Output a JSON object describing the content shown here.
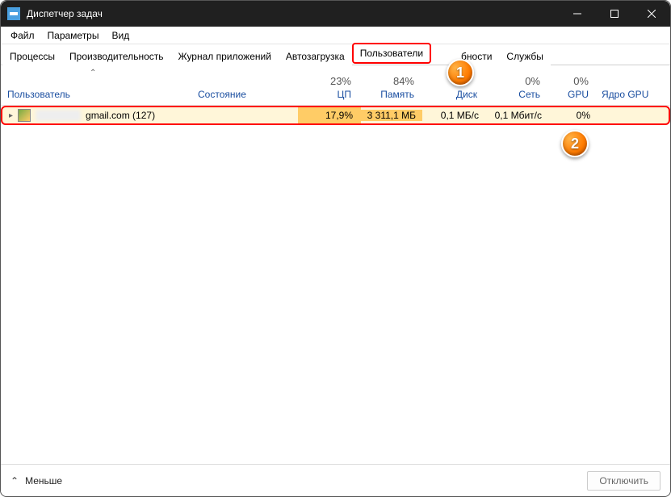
{
  "window": {
    "title": "Диспетчер задач"
  },
  "menu": {
    "file": "Файл",
    "options": "Параметры",
    "view": "Вид"
  },
  "tabs": {
    "processes": "Процессы",
    "performance": "Производительность",
    "app_history": "Журнал приложений",
    "startup": "Автозагрузка",
    "users": "Пользователи",
    "details_obscured": "бности",
    "services": "Службы"
  },
  "headers": {
    "user": "Пользователь",
    "state": "Состояние",
    "cpu_pct": "23%",
    "cpu": "ЦП",
    "mem_pct": "84%",
    "mem": "Память",
    "disk": "Диск",
    "net_pct": "0%",
    "net": "Сеть",
    "gpu_pct": "0%",
    "gpu": "GPU",
    "gpu_core": "Ядро GPU"
  },
  "row": {
    "user_suffix": "gmail.com (127)",
    "cpu": "17,9%",
    "mem": "3 311,1 МБ",
    "disk": "0,1 МБ/с",
    "net": "0,1 Мбит/с",
    "gpu": "0%"
  },
  "footer": {
    "less": "Меньше",
    "disconnect": "Отключить"
  },
  "badges": {
    "one": "1",
    "two": "2"
  }
}
